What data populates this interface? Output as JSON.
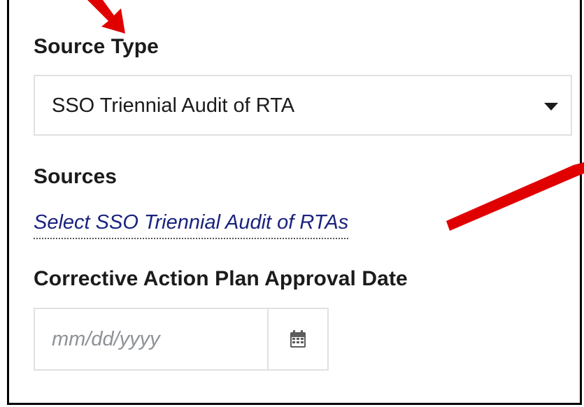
{
  "form": {
    "source_type": {
      "label": "Source Type",
      "selected": "SSO Triennial Audit of RTA"
    },
    "sources": {
      "label": "Sources",
      "link_text": "Select SSO Triennial Audit of RTAs"
    },
    "cap_approval_date": {
      "label": "Corrective Action Plan Approval Date",
      "placeholder": "mm/dd/yyyy",
      "button_icon": "calendar-icon"
    }
  },
  "colors": {
    "text": "#1b1b1b",
    "link": "#1a237e",
    "input_border": "#dfe1e2",
    "placeholder": "#8d9297",
    "annotation_arrow": "#e00000",
    "frame_border": "#000000"
  }
}
